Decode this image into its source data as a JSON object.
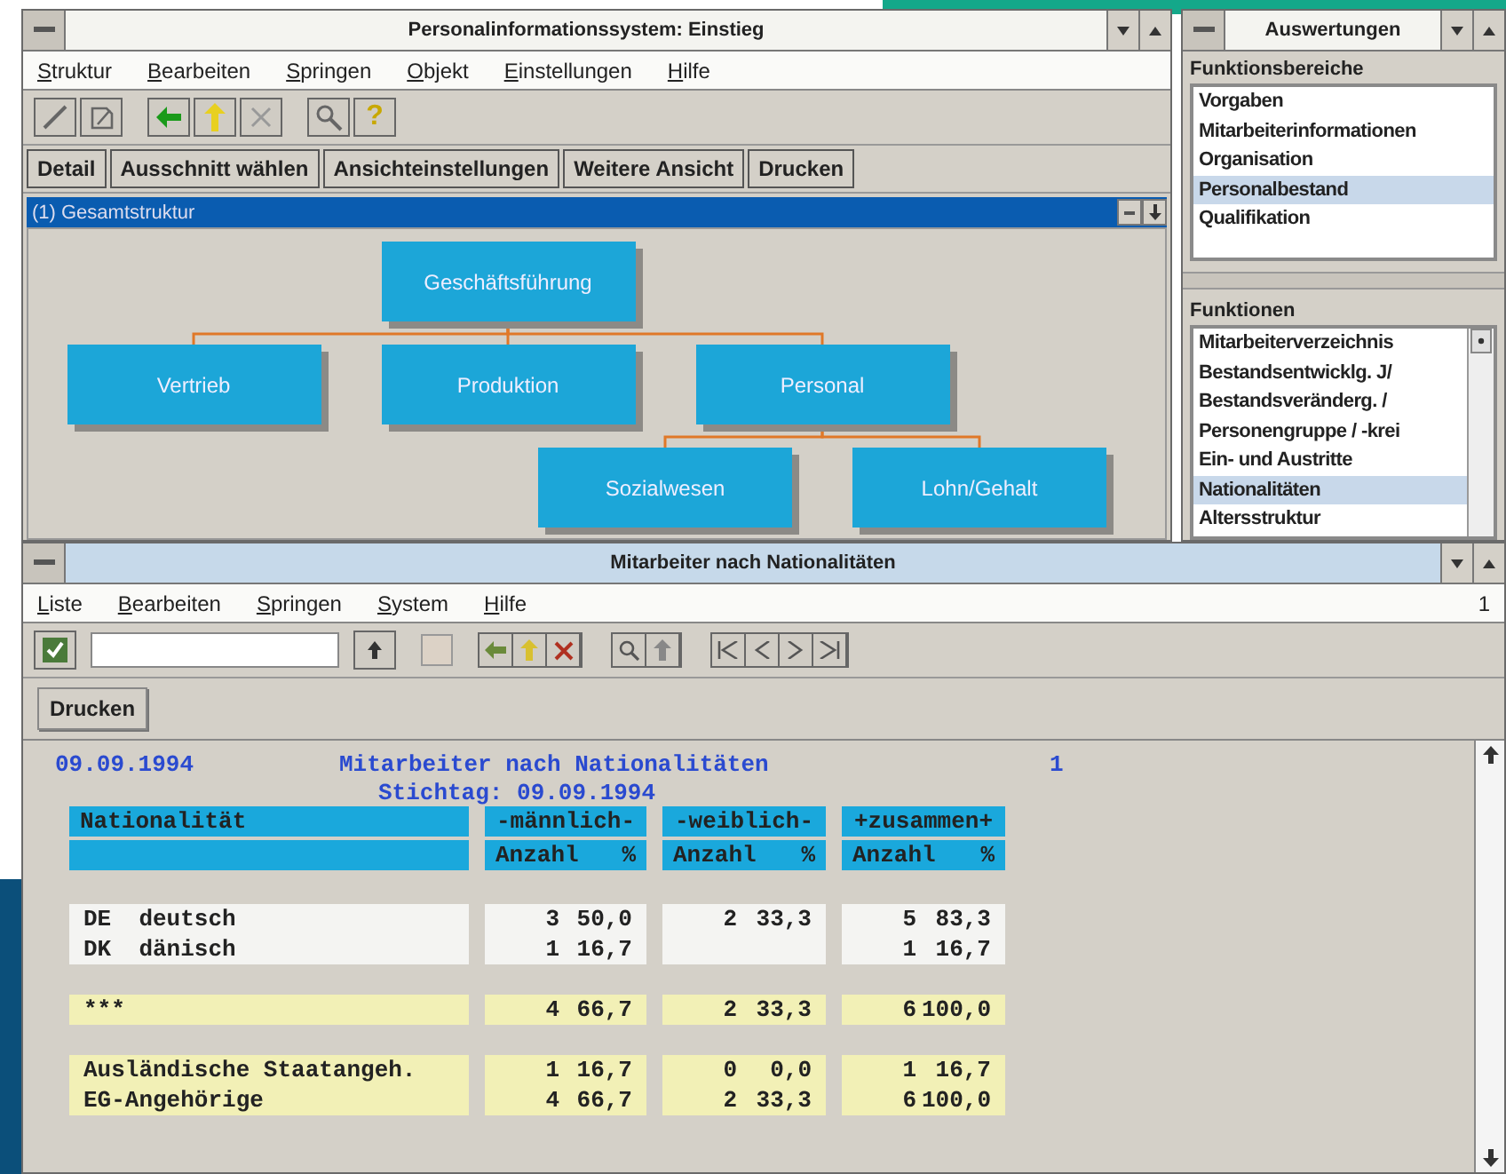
{
  "main_window": {
    "title": "Personalinformationssystem: Einstieg",
    "menu": [
      "Struktur",
      "Bearbeiten",
      "Springen",
      "Objekt",
      "Einstellungen",
      "Hilfe"
    ],
    "help_button": "?",
    "buttons": [
      "Detail",
      "Ausschnitt wählen",
      "Ansichteinstellungen",
      "Weitere Ansicht",
      "Drucken"
    ],
    "tree": {
      "title": "(1) Gesamtstruktur",
      "nodes": [
        {
          "label": "Geschäftsführung",
          "children": [
            {
              "label": "Vertrieb"
            },
            {
              "label": "Produktion"
            },
            {
              "label": "Personal",
              "children": [
                {
                  "label": "Sozialwesen"
                },
                {
                  "label": "Lohn/Gehalt"
                }
              ]
            }
          ]
        }
      ]
    }
  },
  "side_panel": {
    "title": "Auswertungen",
    "sections": [
      {
        "label": "Funktionsbereiche",
        "items": [
          {
            "label": "Vorgaben",
            "selected": false
          },
          {
            "label": "Mitarbeiterinformationen",
            "selected": false
          },
          {
            "label": "Organisation",
            "selected": false
          },
          {
            "label": "Personalbestand",
            "selected": true
          },
          {
            "label": "Qualifikation",
            "selected": false
          }
        ]
      },
      {
        "label": "Funktionen",
        "items": [
          {
            "label": "Mitarbeiterverzeichnis",
            "selected": false
          },
          {
            "label": "Bestandsentwicklg. J/",
            "selected": false
          },
          {
            "label": "Bestandsveränderg. /",
            "selected": false
          },
          {
            "label": "Personengruppe / -krei",
            "selected": false
          },
          {
            "label": "Ein- und Austritte",
            "selected": false
          },
          {
            "label": "Nationalitäten",
            "selected": true
          },
          {
            "label": "Altersstruktur",
            "selected": false
          }
        ]
      }
    ]
  },
  "report_window": {
    "title": "Mitarbeiter nach Nationalitäten",
    "menu": [
      "Liste",
      "Bearbeiten",
      "Springen",
      "System",
      "Hilfe"
    ],
    "page": "1",
    "buttons": [
      "Drucken"
    ],
    "report": {
      "date": "09.09.1994",
      "title": "Mitarbeiter nach Nationalitäten",
      "page": "1",
      "subtitle": "Stichtag: 09.09.1994",
      "columns": [
        "Nationalität",
        "-männlich-",
        "-weiblich-",
        "+zusammen+"
      ],
      "subcolumns": [
        {
          "count": "Anzahl",
          "percent": "%"
        },
        {
          "count": "Anzahl",
          "percent": "%"
        },
        {
          "count": "Anzahl",
          "percent": "%"
        }
      ],
      "groups": [
        {
          "kind": "detail",
          "rows": [
            {
              "label": "DE  deutsch",
              "male": {
                "count": "3",
                "percent": "50,0"
              },
              "female": {
                "count": "2",
                "percent": "33,3"
              },
              "total": {
                "count": "5",
                "percent": "83,3"
              }
            },
            {
              "label": "DK  dänisch",
              "male": {
                "count": "1",
                "percent": "16,7"
              },
              "total": {
                "count": "1",
                "percent": "16,7"
              }
            }
          ]
        },
        {
          "kind": "total",
          "rows": [
            {
              "label": "***",
              "male": {
                "count": "4",
                "percent": "66,7"
              },
              "female": {
                "count": "2",
                "percent": "33,3"
              },
              "total": {
                "count": "6",
                "percent": "100,0"
              }
            }
          ]
        },
        {
          "kind": "total",
          "rows": [
            {
              "label": "Ausländische Staatangeh.",
              "male": {
                "count": "1",
                "percent": "16,7"
              },
              "female": {
                "count": "0",
                "percent": "0,0"
              },
              "total": {
                "count": "1",
                "percent": "16,7"
              }
            },
            {
              "label": "EG-Angehörige",
              "male": {
                "count": "4",
                "percent": "66,7"
              },
              "female": {
                "count": "2",
                "percent": "33,3"
              },
              "total": {
                "count": "6",
                "percent": "100,0"
              }
            }
          ]
        }
      ]
    }
  }
}
